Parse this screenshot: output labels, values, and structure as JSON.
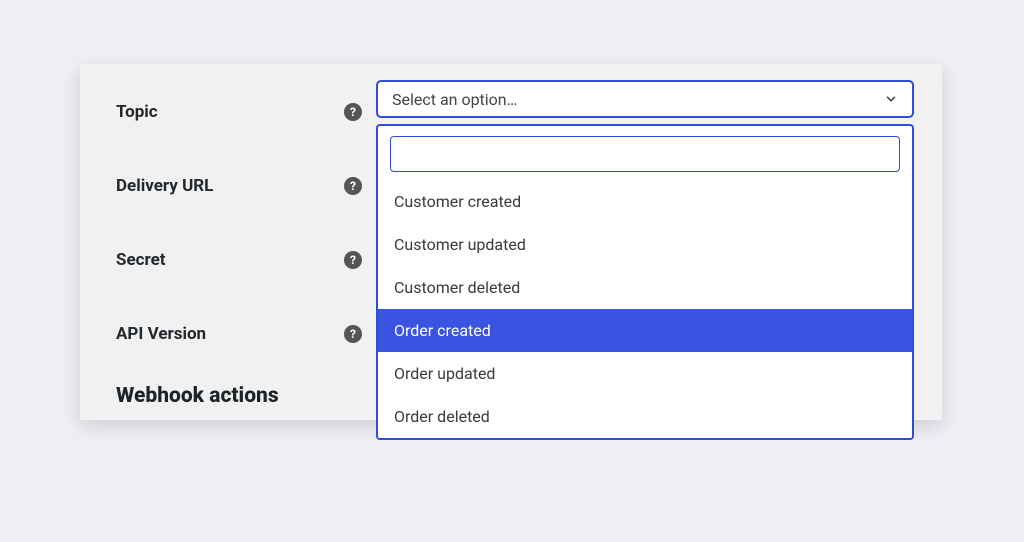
{
  "fields": {
    "topic": {
      "label": "Topic"
    },
    "delivery_url": {
      "label": "Delivery URL"
    },
    "secret": {
      "label": "Secret"
    },
    "api_version": {
      "label": "API Version"
    }
  },
  "section_heading": "Webhook actions",
  "help_glyph": "?",
  "select": {
    "placeholder": "Select an option…",
    "search_value": "",
    "options": [
      {
        "label": "Customer created",
        "highlighted": false
      },
      {
        "label": "Customer updated",
        "highlighted": false
      },
      {
        "label": "Customer deleted",
        "highlighted": false
      },
      {
        "label": "Order created",
        "highlighted": true
      },
      {
        "label": "Order updated",
        "highlighted": false
      },
      {
        "label": "Order deleted",
        "highlighted": false
      }
    ]
  }
}
